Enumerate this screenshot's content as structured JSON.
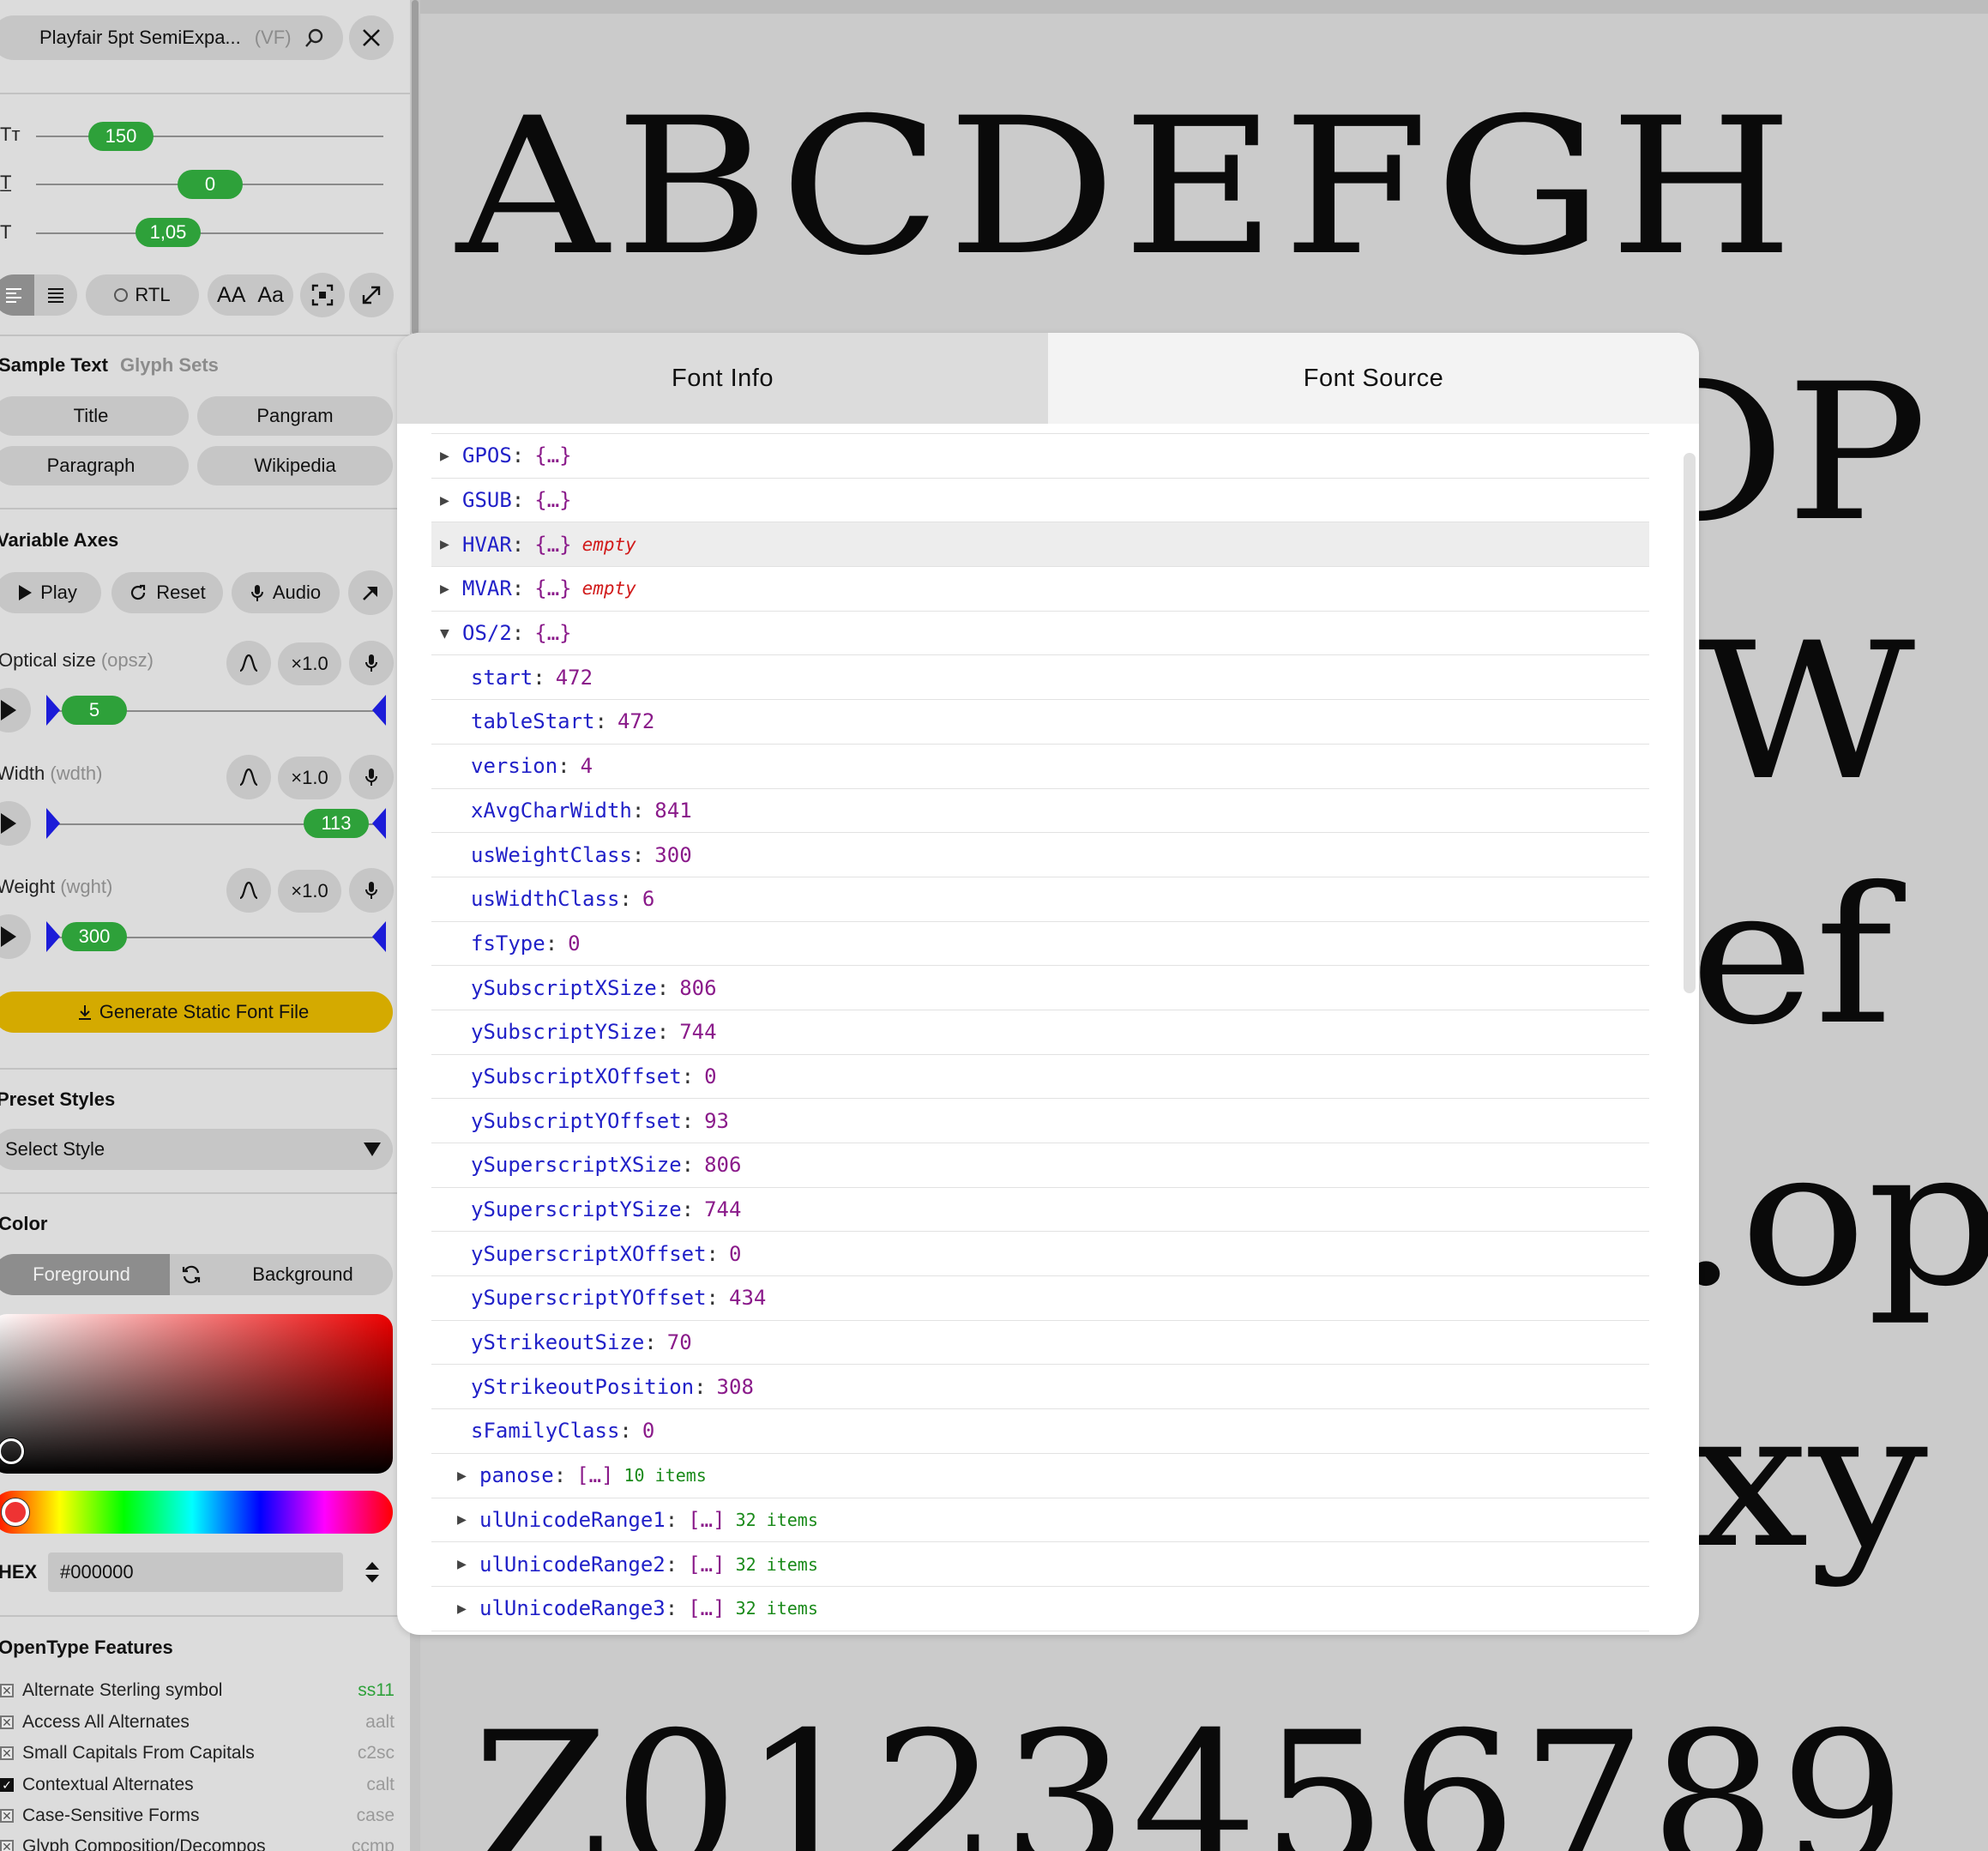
{
  "font_selector": {
    "name": "Playfair 5pt SemiExpa...",
    "tag": "(VF)"
  },
  "metrics": [
    {
      "icon": "font-size-icon",
      "glyph": "Tт",
      "value": "150"
    },
    {
      "icon": "line-height-icon",
      "glyph": "T̲",
      "value": "0"
    },
    {
      "icon": "letter-spacing-icon",
      "glyph": "T",
      "value": "1,05"
    }
  ],
  "toolbar": {
    "rtl_label": "RTL",
    "case_upper": "AA",
    "case_title": "Aa"
  },
  "sample_section": {
    "title": "Sample Text",
    "alt_title": "Glyph Sets",
    "buttons": [
      "Title",
      "Pangram",
      "Paragraph",
      "Wikipedia"
    ]
  },
  "axes_section": {
    "title": "Variable Axes",
    "play_label": "Play",
    "reset_label": "Reset",
    "audio_label": "Audio",
    "axes": [
      {
        "name": "Optical size",
        "tag": "(opsz)",
        "multiplier": "×1.0",
        "value": "5",
        "fraction": 0.0
      },
      {
        "name": "Width",
        "tag": "(wdth)",
        "multiplier": "×1.0",
        "value": "113",
        "fraction": 1.0
      },
      {
        "name": "Weight",
        "tag": "(wght)",
        "multiplier": "×1.0",
        "value": "300",
        "fraction": 0.0
      }
    ],
    "generate_label": "Generate Static Font File"
  },
  "preset_section": {
    "title": "Preset Styles",
    "select_value": "Select Style"
  },
  "color_section": {
    "title": "Color",
    "foreground_label": "Foreground",
    "background_label": "Background",
    "hex_label": "HEX",
    "hex_value": "#000000",
    "hue_color": "#ff0000"
  },
  "opentype_section": {
    "title": "OpenType Features",
    "features": [
      {
        "label": "Alternate Sterling symbol",
        "code": "ss11",
        "state": "excluded",
        "highlight": true
      },
      {
        "label": "Access All Alternates",
        "code": "aalt",
        "state": "excluded",
        "highlight": false
      },
      {
        "label": "Small Capitals From Capitals",
        "code": "c2sc",
        "state": "excluded",
        "highlight": false
      },
      {
        "label": "Contextual Alternates",
        "code": "calt",
        "state": "on",
        "highlight": false
      },
      {
        "label": "Case-Sensitive Forms",
        "code": "case",
        "state": "excluded",
        "highlight": false
      },
      {
        "label": "Glyph Composition/Decompos",
        "code": "ccmp",
        "state": "excluded",
        "highlight": false
      }
    ]
  },
  "preview": {
    "lines": [
      "ABCDEFGH",
      "OP",
      "W",
      "ef",
      ".op",
      "xy",
      "Z0123456789"
    ]
  },
  "dialog": {
    "tabs": [
      "Font Info",
      "Font Source"
    ],
    "active_tab": "Font Source",
    "rows": [
      {
        "arrow": "▶",
        "indent": 0,
        "key": "GPOS",
        "brace": "{…}",
        "note": "",
        "items": "",
        "value": ""
      },
      {
        "arrow": "▶",
        "indent": 0,
        "key": "GSUB",
        "brace": "{…}",
        "note": "",
        "items": "",
        "value": ""
      },
      {
        "arrow": "▶",
        "indent": 0,
        "key": "HVAR",
        "brace": "{…}",
        "note": "empty",
        "items": "",
        "value": "",
        "highlight": true
      },
      {
        "arrow": "▶",
        "indent": 0,
        "key": "MVAR",
        "brace": "{…}",
        "note": "empty",
        "items": "",
        "value": ""
      },
      {
        "arrow": "▼",
        "indent": 0,
        "key": "OS/2",
        "brace": "{…}",
        "note": "",
        "items": "",
        "value": ""
      },
      {
        "arrow": "",
        "indent": 1,
        "key": "start",
        "brace": "",
        "note": "",
        "items": "",
        "value": "472"
      },
      {
        "arrow": "",
        "indent": 1,
        "key": "tableStart",
        "brace": "",
        "note": "",
        "items": "",
        "value": "472"
      },
      {
        "arrow": "",
        "indent": 1,
        "key": "version",
        "brace": "",
        "note": "",
        "items": "",
        "value": "4"
      },
      {
        "arrow": "",
        "indent": 1,
        "key": "xAvgCharWidth",
        "brace": "",
        "note": "",
        "items": "",
        "value": "841"
      },
      {
        "arrow": "",
        "indent": 1,
        "key": "usWeightClass",
        "brace": "",
        "note": "",
        "items": "",
        "value": "300"
      },
      {
        "arrow": "",
        "indent": 1,
        "key": "usWidthClass",
        "brace": "",
        "note": "",
        "items": "",
        "value": "6"
      },
      {
        "arrow": "",
        "indent": 1,
        "key": "fsType",
        "brace": "",
        "note": "",
        "items": "",
        "value": "0"
      },
      {
        "arrow": "",
        "indent": 1,
        "key": "ySubscriptXSize",
        "brace": "",
        "note": "",
        "items": "",
        "value": "806"
      },
      {
        "arrow": "",
        "indent": 1,
        "key": "ySubscriptYSize",
        "brace": "",
        "note": "",
        "items": "",
        "value": "744"
      },
      {
        "arrow": "",
        "indent": 1,
        "key": "ySubscriptXOffset",
        "brace": "",
        "note": "",
        "items": "",
        "value": "0"
      },
      {
        "arrow": "",
        "indent": 1,
        "key": "ySubscriptYOffset",
        "brace": "",
        "note": "",
        "items": "",
        "value": "93"
      },
      {
        "arrow": "",
        "indent": 1,
        "key": "ySuperscriptXSize",
        "brace": "",
        "note": "",
        "items": "",
        "value": "806"
      },
      {
        "arrow": "",
        "indent": 1,
        "key": "ySuperscriptYSize",
        "brace": "",
        "note": "",
        "items": "",
        "value": "744"
      },
      {
        "arrow": "",
        "indent": 1,
        "key": "ySuperscriptXOffset",
        "brace": "",
        "note": "",
        "items": "",
        "value": "0"
      },
      {
        "arrow": "",
        "indent": 1,
        "key": "ySuperscriptYOffset",
        "brace": "",
        "note": "",
        "items": "",
        "value": "434"
      },
      {
        "arrow": "",
        "indent": 1,
        "key": "yStrikeoutSize",
        "brace": "",
        "note": "",
        "items": "",
        "value": "70"
      },
      {
        "arrow": "",
        "indent": 1,
        "key": "yStrikeoutPosition",
        "brace": "",
        "note": "",
        "items": "",
        "value": "308"
      },
      {
        "arrow": "",
        "indent": 1,
        "key": "sFamilyClass",
        "brace": "",
        "note": "",
        "items": "",
        "value": "0"
      },
      {
        "arrow": "▶",
        "indent": 1,
        "key": "panose",
        "brace": "[…]",
        "note": "",
        "items": "10 items",
        "value": ""
      },
      {
        "arrow": "▶",
        "indent": 1,
        "key": "ulUnicodeRange1",
        "brace": "[…]",
        "note": "",
        "items": "32 items",
        "value": ""
      },
      {
        "arrow": "▶",
        "indent": 1,
        "key": "ulUnicodeRange2",
        "brace": "[…]",
        "note": "",
        "items": "32 items",
        "value": ""
      },
      {
        "arrow": "▶",
        "indent": 1,
        "key": "ulUnicodeRange3",
        "brace": "[…]",
        "note": "",
        "items": "32 items",
        "value": ""
      }
    ]
  }
}
